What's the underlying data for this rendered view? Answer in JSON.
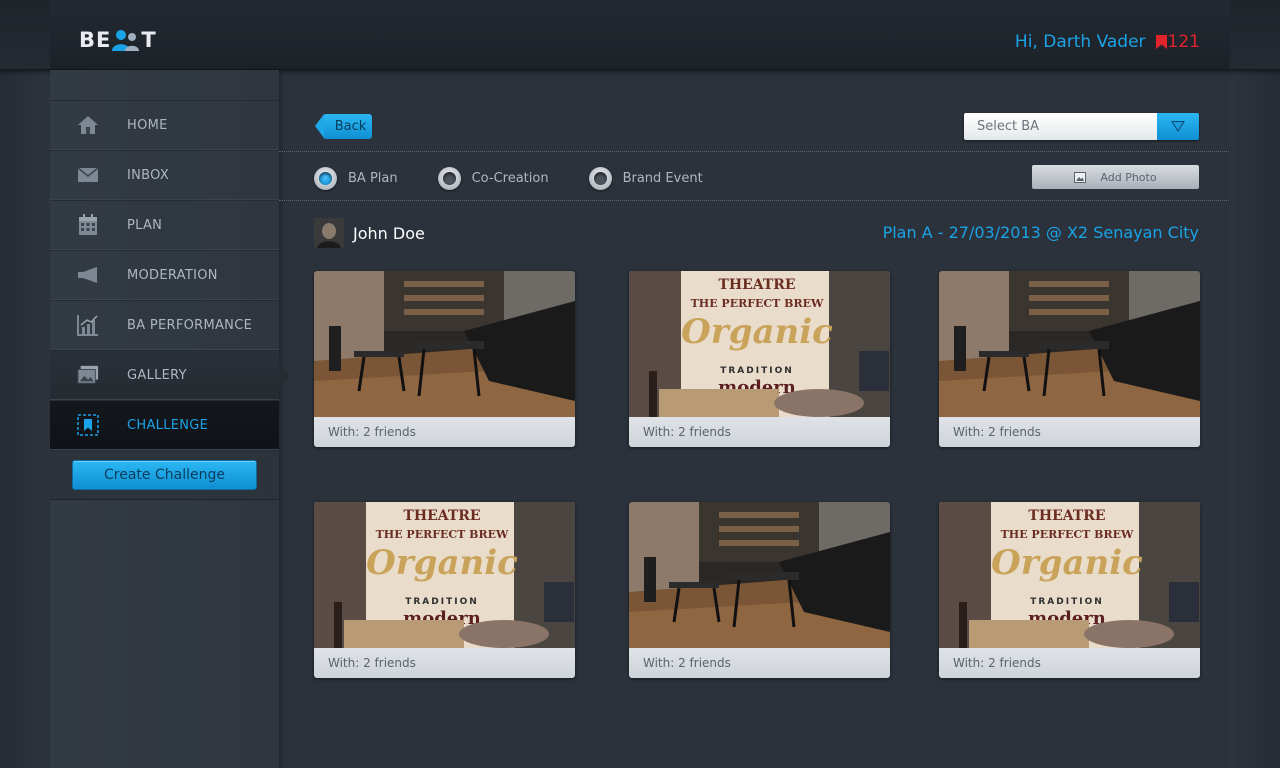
{
  "header": {
    "logo_left": "BE",
    "logo_right": "T",
    "greeting": "Hi, Darth Vader",
    "notification_count": "121"
  },
  "sidebar": {
    "items": [
      {
        "label": "HOME",
        "icon": "home-icon"
      },
      {
        "label": "INBOX",
        "icon": "mail-icon"
      },
      {
        "label": "PLAN",
        "icon": "calendar-icon"
      },
      {
        "label": "MODERATION",
        "icon": "megaphone-icon"
      },
      {
        "label": "BA PERFORMANCE",
        "icon": "chart-icon"
      },
      {
        "label": "GALLERY",
        "icon": "gallery-icon"
      },
      {
        "label": "CHALLENGE",
        "icon": "bookmark-icon",
        "active": true
      }
    ],
    "create_button": "Create Challenge"
  },
  "toolbar": {
    "back_label": "Back",
    "select_placeholder": "Select BA",
    "add_photo_label": "Add Photo"
  },
  "filters": [
    {
      "label": "BA Plan",
      "selected": true
    },
    {
      "label": "Co-Creation",
      "selected": false
    },
    {
      "label": "Brand Event",
      "selected": false
    }
  ],
  "post": {
    "user_name": "John Doe",
    "plan_title": "Plan A - 27/03/2013 @ X2 Senayan City"
  },
  "photos": [
    {
      "caption": "With: 2 friends",
      "scene": "cafe-interior"
    },
    {
      "caption": "With: 2 friends",
      "scene": "theatre-mural"
    },
    {
      "caption": "With: 2 friends",
      "scene": "cafe-interior"
    },
    {
      "caption": "With: 2 friends",
      "scene": "theatre-mural"
    },
    {
      "caption": "With: 2 friends",
      "scene": "cafe-interior"
    },
    {
      "caption": "With: 2 friends",
      "scene": "theatre-mural"
    }
  ],
  "mural_text": {
    "line1": "THEATRE",
    "line2": "THE PERFECT BREW",
    "line3": "Organic",
    "line4": "TRADITION",
    "line5": "modern"
  },
  "colors": {
    "accent": "#1aa3e6",
    "badge": "#e1232b",
    "background": "#2b323b",
    "sidebar": "#323a44"
  }
}
